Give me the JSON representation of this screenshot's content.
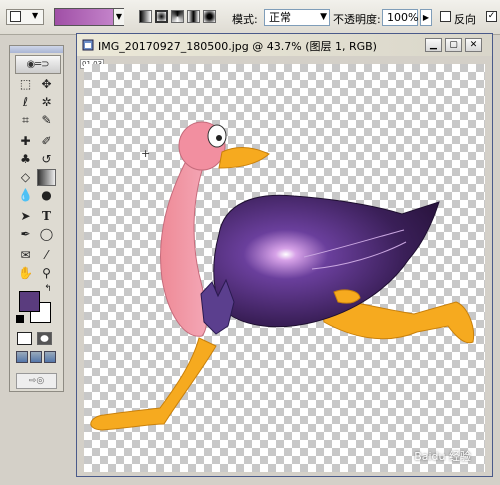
{
  "options_bar": {
    "mode_label": "模式:",
    "mode_value": "正常",
    "opacity_label": "不透明度:",
    "opacity_value": "100%",
    "reverse_label": "反向",
    "gradient_colors": [
      "#a04fa6",
      "#c98cd0"
    ]
  },
  "toolbox": {
    "foreground_color": "#5a3c7e",
    "background_color": "#ffffff",
    "tools": [
      "marquee-tool",
      "move-tool",
      "lasso-tool",
      "magic-wand-tool",
      "crop-tool",
      "slice-tool",
      "healing-brush-tool",
      "brush-tool",
      "clone-stamp-tool",
      "history-brush-tool",
      "eraser-tool",
      "gradient-tool",
      "blur-tool",
      "dodge-tool",
      "path-selection-tool",
      "type-tool",
      "pen-tool",
      "shape-tool",
      "notes-tool",
      "eyedropper-tool",
      "hand-tool",
      "zoom-tool"
    ]
  },
  "document": {
    "title": "IMG_20170927_180500.jpg @ 43.7% (图层 1, RGB)",
    "ruler_corner": "01 03"
  },
  "watermark": "Baidu 经验"
}
